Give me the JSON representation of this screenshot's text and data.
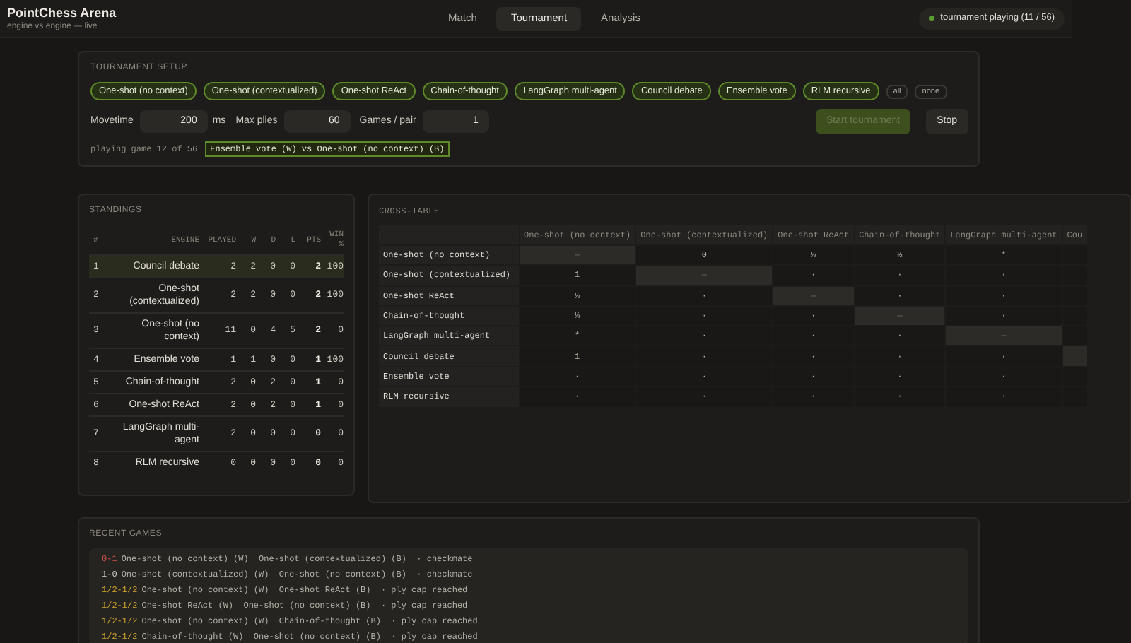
{
  "app": {
    "title": "PointChess Arena",
    "subtitle": "engine vs engine — live"
  },
  "tabs": [
    {
      "label": "Match",
      "selected": false
    },
    {
      "label": "Tournament",
      "selected": true
    },
    {
      "label": "Analysis",
      "selected": false
    }
  ],
  "status": {
    "label": "tournament playing (11 / 56)",
    "on": true
  },
  "setup": {
    "title": "TOURNAMENT SETUP",
    "engines": [
      {
        "label": "One-shot (no context)",
        "selected": true
      },
      {
        "label": "One-shot (contextualized)",
        "selected": true
      },
      {
        "label": "One-shot ReAct",
        "selected": true
      },
      {
        "label": "Chain-of-thought",
        "selected": true
      },
      {
        "label": "LangGraph multi-agent",
        "selected": true
      },
      {
        "label": "Council debate",
        "selected": true
      },
      {
        "label": "Ensemble vote",
        "selected": true
      },
      {
        "label": "RLM recursive",
        "selected": true
      }
    ],
    "select_all": "all",
    "select_none": "none",
    "movetime_label": "Movetime",
    "movetime": "200",
    "movetime_unit": "ms",
    "maxplies_label": "Max plies",
    "maxplies": "60",
    "games_label": "Games / pair",
    "games": "1",
    "start": {
      "label": "Start tournament",
      "disabled": true
    },
    "stop": "Stop",
    "progress": "playing game 12 of 56",
    "current": "Ensemble vote (W) vs One-shot (no context) (B)"
  },
  "standings": {
    "title": "STANDINGS",
    "columns": [
      "#",
      "ENGINE",
      "PLAYED",
      "W",
      "D",
      "L",
      "PTS",
      "WIN %"
    ],
    "rows": [
      {
        "cells": [
          "1",
          "Council debate",
          "2",
          "2",
          "0",
          "0",
          "2",
          "100"
        ],
        "selected": true
      },
      {
        "cells": [
          "2",
          "One-shot (contextualized)",
          "2",
          "2",
          "0",
          "0",
          "2",
          "100"
        ],
        "selected": false
      },
      {
        "cells": [
          "3",
          "One-shot (no context)",
          "11",
          "0",
          "4",
          "5",
          "2",
          "0"
        ],
        "selected": false
      },
      {
        "cells": [
          "4",
          "Ensemble vote",
          "1",
          "1",
          "0",
          "0",
          "1",
          "100"
        ],
        "selected": false
      },
      {
        "cells": [
          "5",
          "Chain-of-thought",
          "2",
          "0",
          "2",
          "0",
          "1",
          "0"
        ],
        "selected": false
      },
      {
        "cells": [
          "6",
          "One-shot ReAct",
          "2",
          "0",
          "2",
          "0",
          "1",
          "0"
        ],
        "selected": false
      },
      {
        "cells": [
          "7",
          "LangGraph multi-agent",
          "2",
          "0",
          "0",
          "0",
          "0",
          "0"
        ],
        "selected": false
      },
      {
        "cells": [
          "8",
          "RLM recursive",
          "0",
          "0",
          "0",
          "0",
          "0",
          "0"
        ],
        "selected": false
      }
    ]
  },
  "cross_table": {
    "title": "CROSS-TABLE",
    "columns": [
      "One-shot (no context)",
      "One-shot (contextualized)",
      "One-shot ReAct",
      "Chain-of-thought",
      "LangGraph multi-agent",
      "Cou"
    ],
    "rows": [
      {
        "label": "One-shot (no context)",
        "cells": [
          "—",
          "0",
          "½",
          "½",
          "*"
        ]
      },
      {
        "label": "One-shot (contextualized)",
        "cells": [
          "1",
          "—",
          "·",
          "·",
          "·"
        ]
      },
      {
        "label": "One-shot ReAct",
        "cells": [
          "½",
          "·",
          "—",
          "·",
          "·"
        ]
      },
      {
        "label": "Chain-of-thought",
        "cells": [
          "½",
          "·",
          "·",
          "—",
          "·"
        ]
      },
      {
        "label": "LangGraph multi-agent",
        "cells": [
          "*",
          "·",
          "·",
          "·",
          "—"
        ]
      },
      {
        "label": "Council debate",
        "cells": [
          "1",
          "·",
          "·",
          "·",
          "·"
        ]
      },
      {
        "label": "Ensemble vote",
        "cells": [
          "·",
          "·",
          "·",
          "·",
          "·"
        ]
      },
      {
        "label": "RLM recursive",
        "cells": [
          "·",
          "·",
          "·",
          "·",
          "·"
        ]
      }
    ]
  },
  "recent_games": {
    "title": "RECENT GAMES",
    "games": [
      {
        "result": "0-1",
        "kind": "black",
        "text": "One-shot (no context) (W)  One-shot (contextualized) (B)  · checkmate"
      },
      {
        "result": "1-0",
        "kind": "white",
        "text": "One-shot (contextualized) (W)  One-shot (no context) (B)  · checkmate"
      },
      {
        "result": "1/2-1/2",
        "kind": "draw",
        "text": "One-shot (no context) (W)  One-shot ReAct (B)  · ply cap reached"
      },
      {
        "result": "1/2-1/2",
        "kind": "draw",
        "text": "One-shot ReAct (W)  One-shot (no context) (B)  · ply cap reached"
      },
      {
        "result": "1/2-1/2",
        "kind": "draw",
        "text": "One-shot (no context) (W)  Chain-of-thought (B)  · ply cap reached"
      },
      {
        "result": "1/2-1/2",
        "kind": "draw",
        "text": "Chain-of-thought (W)  One-shot (no context) (B)  · ply cap reached"
      }
    ]
  }
}
